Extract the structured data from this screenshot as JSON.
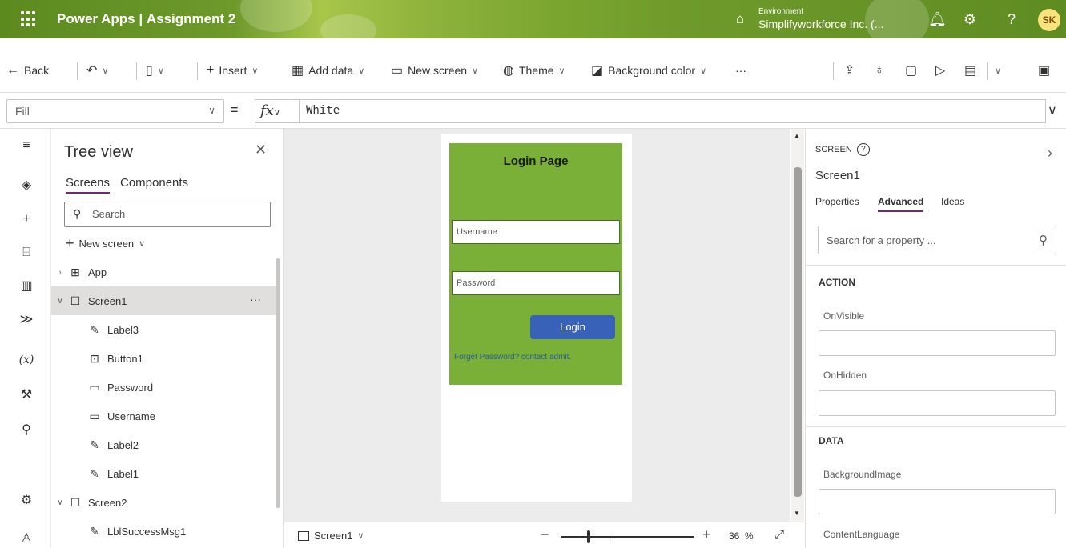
{
  "topbar": {
    "app_name": "Power Apps",
    "divider": "|",
    "doc_name": "Assignment 2",
    "env_label": "Environment",
    "env_value": "Simplifyworkforce Inc. (...",
    "avatar": "SK"
  },
  "commands": {
    "back": "Back",
    "insert": "Insert",
    "add_data": "Add data",
    "new_screen": "New screen",
    "theme": "Theme",
    "background_color": "Background color",
    "more": "···"
  },
  "formula": {
    "property": "Fill",
    "equals": "=",
    "fx": "fx",
    "expression": "White"
  },
  "tree": {
    "title": "Tree view",
    "tabs": [
      "Screens",
      "Components"
    ],
    "search_placeholder": "Search",
    "new_screen": "New screen",
    "items": [
      "App",
      "Screen1",
      "Label3",
      "Button1",
      "Password",
      "Username",
      "Label2",
      "Label1",
      "Screen2",
      "LblSuccessMsg1"
    ],
    "more": "···"
  },
  "canvas": {
    "login_title": "Login Page",
    "username_placeholder": "Username",
    "password_placeholder": "Password",
    "login_button": "Login",
    "forget_text": "Forget Password? contact admit."
  },
  "status": {
    "screen": "Screen1",
    "zoom_value": "36",
    "zoom_unit": "%"
  },
  "properties": {
    "kind": "SCREEN",
    "name": "Screen1",
    "tabs": [
      "Properties",
      "Advanced",
      "Ideas"
    ],
    "search_placeholder": "Search for a property ...",
    "section_action": "ACTION",
    "on_visible": "OnVisible",
    "on_hidden": "OnHidden",
    "section_data": "DATA",
    "background_image": "BackgroundImage",
    "content_language": "ContentLanguage"
  },
  "colors": {
    "accent": "#742774",
    "canvas_green": "#7ab037",
    "login_button": "#3762b8"
  },
  "icons": {
    "waffle": "waffle-icon",
    "environment": "environment-icon",
    "notifications": "bell-icon",
    "settings": "gear-icon",
    "help": "help-icon"
  }
}
